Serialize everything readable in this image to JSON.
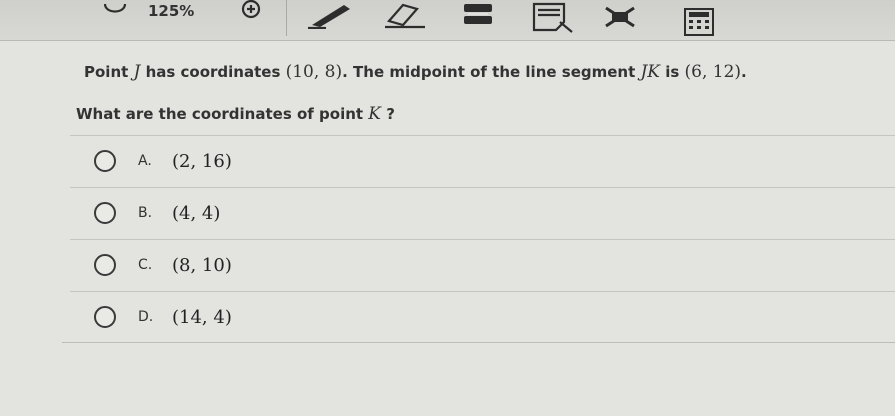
{
  "toolbar": {
    "zoom_label": "125%",
    "icons": [
      "undo-icon",
      "zoom-in-icon",
      "pen-icon",
      "eraser-icon",
      "highlighter-icon",
      "notepad-icon",
      "eliminate-icon",
      "calculator-icon"
    ]
  },
  "question": {
    "text_before": "Point ",
    "point_j": "J",
    "text_mid": " has coordinates ",
    "coords": "(10, 8)",
    "text_after": ". The midpoint of the line segment ",
    "segment": "JK",
    "text_is": " is ",
    "midpoint": "(6, 12)",
    "period": "."
  },
  "prompt": {
    "text": "What are the coordinates of point ",
    "point_k": "K",
    "suffix": " ?"
  },
  "options": [
    {
      "letter": "A.",
      "value": "(2, 16)"
    },
    {
      "letter": "B.",
      "value": "(4, 4)"
    },
    {
      "letter": "C.",
      "value": "(8, 10)"
    },
    {
      "letter": "D.",
      "value": "(14, 4)"
    }
  ]
}
